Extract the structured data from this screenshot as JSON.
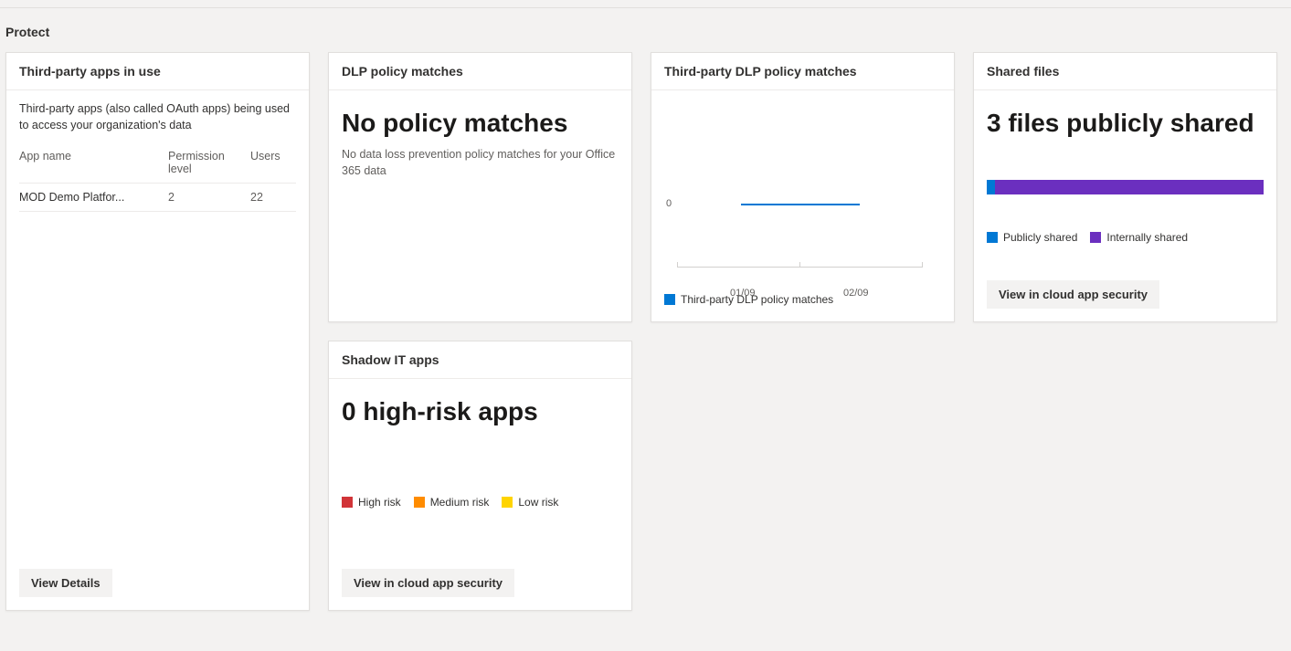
{
  "section": {
    "title": "Protect"
  },
  "cards": {
    "thirdPartyApps": {
      "title": "Third-party apps in use",
      "desc": "Third-party apps (also called OAuth apps) being used to access your organization's data",
      "columns": {
        "name": "App name",
        "perm": "Permission level",
        "users": "Users"
      },
      "rows": [
        {
          "name": "MOD Demo Platfor...",
          "perm": "2",
          "users": "22"
        }
      ],
      "button": "View Details"
    },
    "dlp": {
      "title": "DLP policy matches",
      "headline": "No policy matches",
      "body": "No data loss prevention policy matches for your Office 365 data"
    },
    "thirdPartyDlp": {
      "title": "Third-party DLP policy matches",
      "yLabel": "0",
      "xLabels": [
        "01/09",
        "02/09"
      ],
      "legend": "Third-party DLP policy matches"
    },
    "sharedFiles": {
      "title": "Shared files",
      "headline": "3 files publicly shared",
      "legend": {
        "public": "Publicly shared",
        "internal": "Internally shared"
      },
      "button": "View in cloud app security"
    },
    "shadowIT": {
      "title": "Shadow IT apps",
      "headline": "0 high-risk apps",
      "legend": {
        "high": "High risk",
        "medium": "Medium risk",
        "low": "Low risk"
      },
      "button": "View in cloud app security"
    }
  },
  "chart_data": [
    {
      "type": "line",
      "title": "Third-party DLP policy matches",
      "x": [
        "01/09",
        "02/09"
      ],
      "series": [
        {
          "name": "Third-party DLP policy matches",
          "values": [
            0,
            0
          ]
        }
      ],
      "ylim": [
        0,
        1
      ],
      "ylabel": "",
      "xlabel": ""
    },
    {
      "type": "bar",
      "title": "Shared files",
      "categories": [
        "Publicly shared",
        "Internally shared"
      ],
      "values": [
        3,
        97
      ],
      "orientation": "horizontal-stacked"
    }
  ]
}
